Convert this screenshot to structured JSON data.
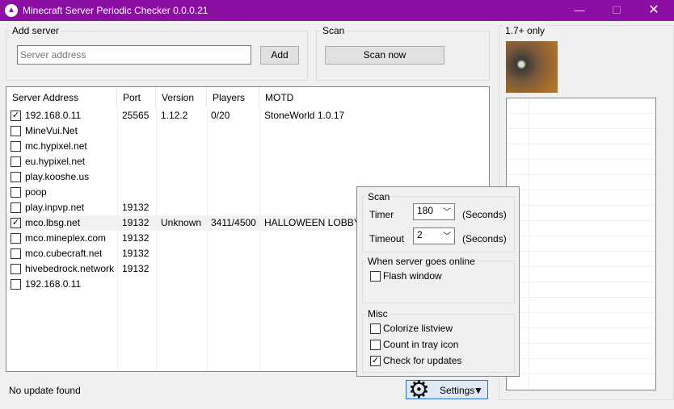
{
  "window": {
    "title": "Minecraft Server Periodic Checker 0.0.0.21",
    "app_icon": "triangle-logo-icon",
    "minimize": "—",
    "maximize": "☐",
    "close": "✕"
  },
  "add_server": {
    "group_label": "Add server",
    "placeholder": "Server address",
    "add_label": "Add"
  },
  "scan": {
    "group_label": "Scan",
    "scan_now_label": "Scan now"
  },
  "list": {
    "columns": [
      "Server Address",
      "Port",
      "Version",
      "Players",
      "MOTD"
    ],
    "rows": [
      {
        "checked": true,
        "address": "192.168.0.11",
        "port": "25565",
        "version": "1.12.2",
        "players": "0/20",
        "motd": "StoneWorld 1.0.17"
      },
      {
        "checked": false,
        "address": "MineVui.Net",
        "port": "",
        "version": "",
        "players": "",
        "motd": ""
      },
      {
        "checked": false,
        "address": "mc.hypixel.net",
        "port": "",
        "version": "",
        "players": "",
        "motd": ""
      },
      {
        "checked": false,
        "address": "eu.hypixel.net",
        "port": "",
        "version": "",
        "players": "",
        "motd": ""
      },
      {
        "checked": false,
        "address": "play.kooshe.us",
        "port": "",
        "version": "",
        "players": "",
        "motd": ""
      },
      {
        "checked": false,
        "address": "poop",
        "port": "",
        "version": "",
        "players": "",
        "motd": ""
      },
      {
        "checked": false,
        "address": "play.inpvp.net",
        "port": "19132",
        "version": "",
        "players": "",
        "motd": ""
      },
      {
        "checked": true,
        "address": "mco.lbsg.net",
        "port": "19132",
        "version": "Unknown",
        "players": "3411/4500",
        "motd": "HALLOWEEN LOBBY!"
      },
      {
        "checked": false,
        "address": "mco.mineplex.com",
        "port": "19132",
        "version": "",
        "players": "",
        "motd": ""
      },
      {
        "checked": false,
        "address": "mco.cubecraft.net",
        "port": "19132",
        "version": "",
        "players": "",
        "motd": ""
      },
      {
        "checked": false,
        "address": "hivebedrock.network",
        "port": "19132",
        "version": "",
        "players": "",
        "motd": ""
      },
      {
        "checked": false,
        "address": "192.168.0.11",
        "port": "",
        "version": "",
        "players": "",
        "motd": ""
      }
    ]
  },
  "status": {
    "text": "No update found"
  },
  "right_panel": {
    "label": "1.7+ only"
  },
  "settings_popup": {
    "scan_group": "Scan",
    "timer_label": "Timer",
    "timer_value": "180",
    "timeout_label": "Timeout",
    "timeout_value": "2",
    "seconds_label": "(Seconds)",
    "online_group": "When server goes online",
    "flash_window": "Flash window",
    "misc_group": "Misc",
    "colorize": "Colorize listview",
    "tray": "Count in tray icon",
    "updates": "Check for updates",
    "flash_checked": false,
    "colorize_checked": false,
    "tray_checked": false,
    "updates_checked": true
  },
  "settings_button": {
    "label": "Settings",
    "arrow": "▼",
    "icon": "gear-icon"
  }
}
